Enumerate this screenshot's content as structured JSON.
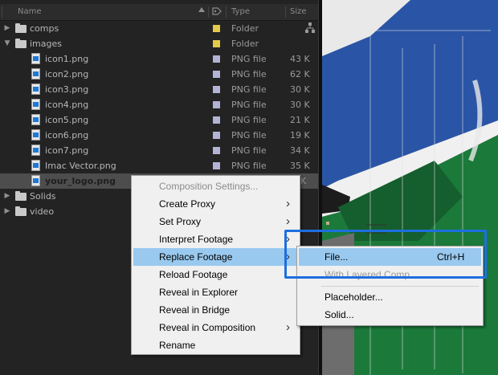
{
  "project": {
    "columns": {
      "name": "Name",
      "type": "Type",
      "size": "Size"
    },
    "rows": [
      {
        "name": "comps",
        "kind": "folder",
        "expanded": false,
        "type": "Folder",
        "size": "",
        "label_color": "#e6c84a"
      },
      {
        "name": "images",
        "kind": "folder",
        "expanded": true,
        "type": "Folder",
        "size": "",
        "label_color": "#e6c84a"
      },
      {
        "name": "icon1.png",
        "kind": "file",
        "type": "PNG file",
        "size": "43 K",
        "label_color": "#b3b3d6"
      },
      {
        "name": "icon2.png",
        "kind": "file",
        "type": "PNG file",
        "size": "62 K",
        "label_color": "#b3b3d6"
      },
      {
        "name": "icon3.png",
        "kind": "file",
        "type": "PNG file",
        "size": "30 K",
        "label_color": "#b3b3d6"
      },
      {
        "name": "icon4.png",
        "kind": "file",
        "type": "PNG file",
        "size": "30 K",
        "label_color": "#b3b3d6"
      },
      {
        "name": "icon5.png",
        "kind": "file",
        "type": "PNG file",
        "size": "21 K",
        "label_color": "#b3b3d6"
      },
      {
        "name": "icon6.png",
        "kind": "file",
        "type": "PNG file",
        "size": "19 K",
        "label_color": "#b3b3d6"
      },
      {
        "name": "icon7.png",
        "kind": "file",
        "type": "PNG file",
        "size": "34 K",
        "label_color": "#b3b3d6"
      },
      {
        "name": "Imac Vector.png",
        "kind": "file",
        "type": "PNG file",
        "size": "35 K",
        "label_color": "#b3b3d6"
      },
      {
        "name": "your_logo.png",
        "kind": "file",
        "selected": true,
        "type": "",
        "size": "K",
        "label_color": "#b3b3d6"
      },
      {
        "name": "Solids",
        "kind": "folder",
        "expanded": false,
        "type": "",
        "size": "",
        "label_color": "#e6c84a"
      },
      {
        "name": "video",
        "kind": "folder",
        "expanded": false,
        "type": "",
        "size": "",
        "label_color": "#e6c84a"
      }
    ]
  },
  "context_menu": {
    "items": [
      {
        "label": "Composition Settings...",
        "disabled": true,
        "submenu": false
      },
      {
        "label": "Create Proxy",
        "submenu": true
      },
      {
        "label": "Set Proxy",
        "submenu": true
      },
      {
        "label": "Interpret Footage",
        "submenu": true
      },
      {
        "label": "Replace Footage",
        "submenu": true,
        "highlighted": true
      },
      {
        "label": "Reload Footage",
        "submenu": false
      },
      {
        "label": "Reveal in Explorer",
        "submenu": false
      },
      {
        "label": "Reveal in Bridge",
        "submenu": false
      },
      {
        "label": "Reveal in Composition",
        "submenu": true
      },
      {
        "label": "Rename",
        "submenu": false
      }
    ]
  },
  "submenu": {
    "items": [
      {
        "label": "File...",
        "shortcut": "Ctrl+H",
        "highlighted": true
      },
      {
        "label": "With Layered Comp",
        "disabled": true
      },
      {
        "label": "Placeholder..."
      },
      {
        "label": "Solid..."
      }
    ]
  },
  "colors": {
    "folder_label": "#e6c84a",
    "file_label": "#b3b3d6",
    "menu_highlight": "#99c9ef",
    "callout": "#1d6fe0"
  }
}
